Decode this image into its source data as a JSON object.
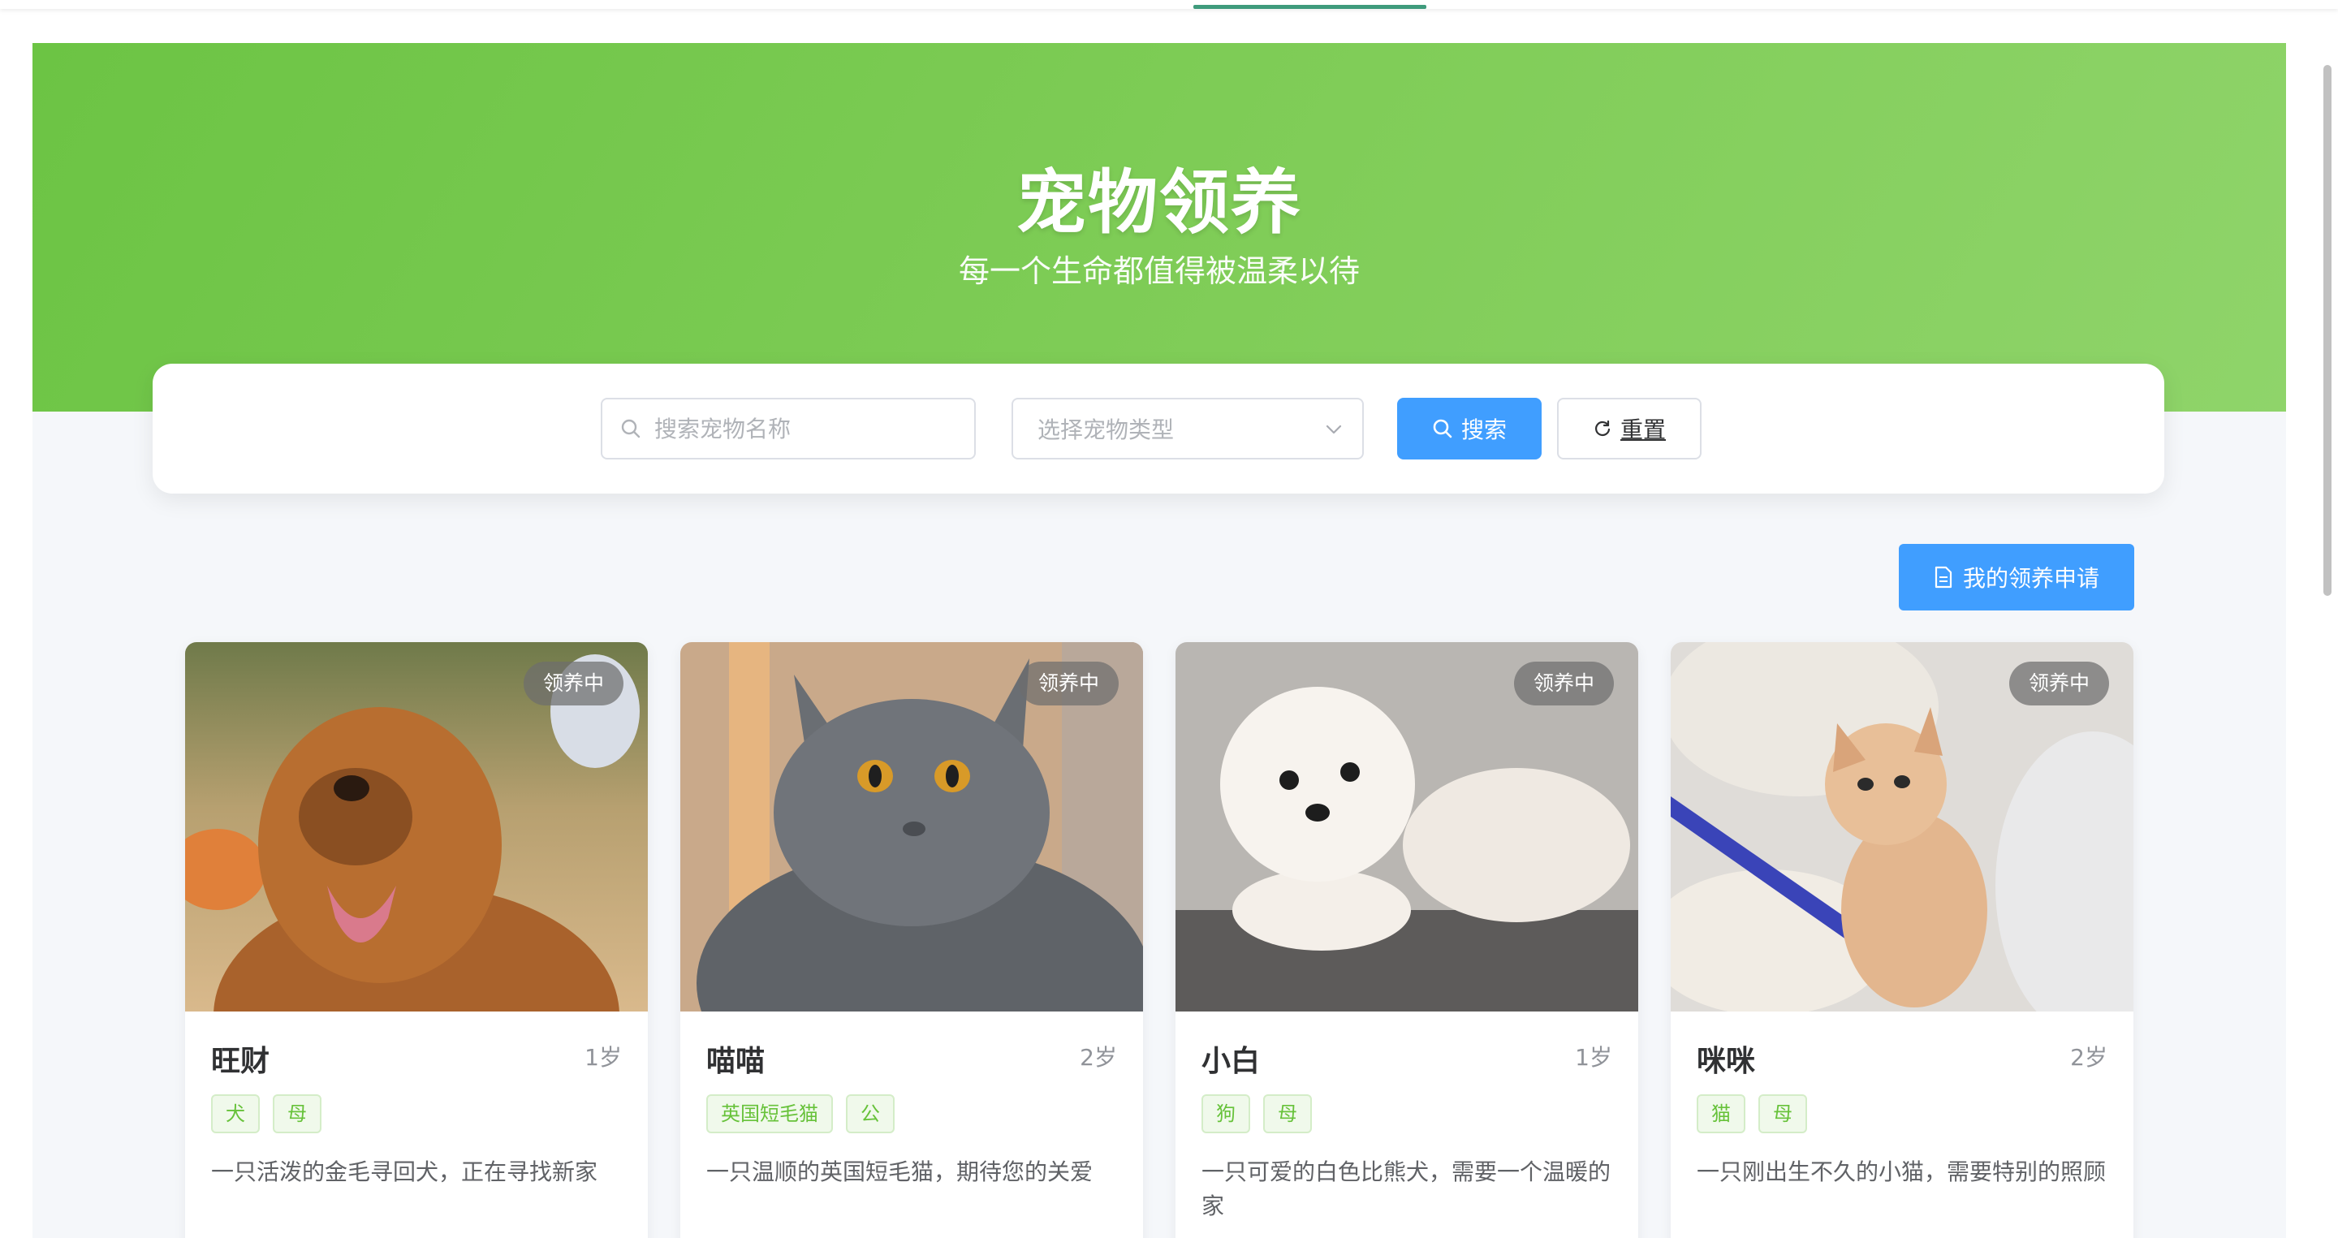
{
  "hero": {
    "title": "宠物领养",
    "subtitle": "每一个生命都值得被温柔以待"
  },
  "search": {
    "name_placeholder": "搜索宠物名称",
    "type_placeholder": "选择宠物类型",
    "search_button": "搜索",
    "reset_button": "重置"
  },
  "actions": {
    "my_applications": "我的领养申请"
  },
  "pets": [
    {
      "name": "旺财",
      "age": "1岁",
      "status": "领养中",
      "tags": [
        "犬",
        "母"
      ],
      "description": "一只活泼的金毛寻回犬，正在寻找新家"
    },
    {
      "name": "喵喵",
      "age": "2岁",
      "status": "领养中",
      "tags": [
        "英国短毛猫",
        "公"
      ],
      "description": "一只温顺的英国短毛猫，期待您的关爱"
    },
    {
      "name": "小白",
      "age": "1岁",
      "status": "领养中",
      "tags": [
        "狗",
        "母"
      ],
      "description": "一只可爱的白色比熊犬，需要一个温暖的家"
    },
    {
      "name": "咪咪",
      "age": "2岁",
      "status": "领养中",
      "tags": [
        "猫",
        "母"
      ],
      "description": "一只刚出生不久的小猫，需要特别的照顾"
    }
  ],
  "colors": {
    "hero_green": "#6cc444",
    "primary_blue": "#409eff",
    "tag_green": "#67c23a"
  }
}
